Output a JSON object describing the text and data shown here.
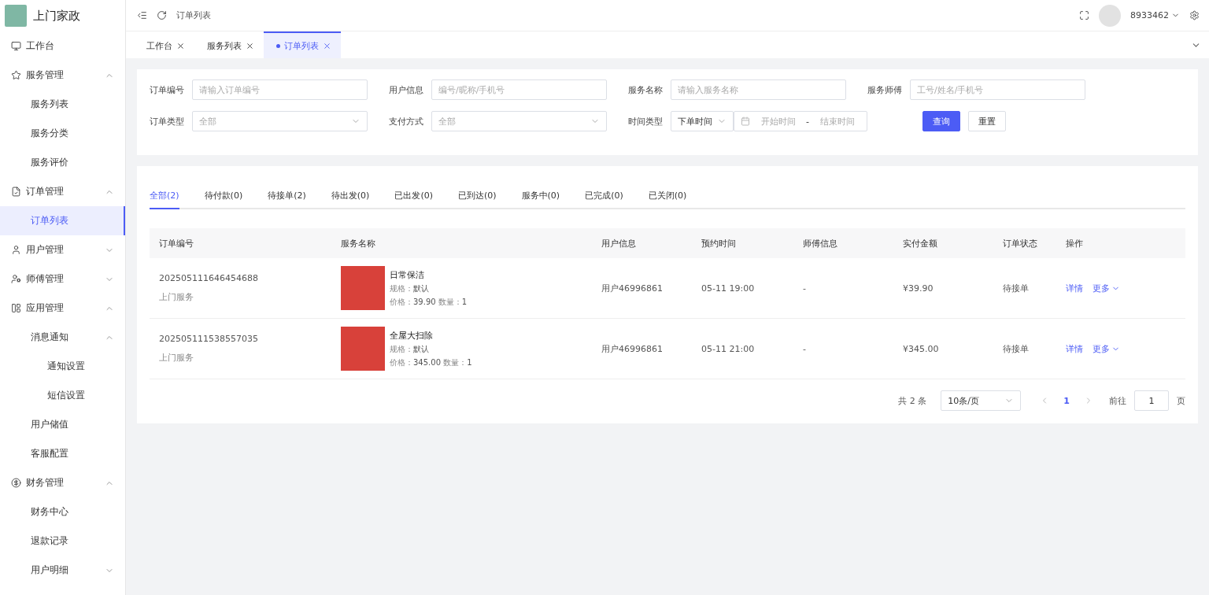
{
  "app": {
    "title": "上门家政"
  },
  "sidebar": {
    "items": [
      {
        "label": "工作台",
        "selected": false
      },
      {
        "label": "服务管理",
        "selected": false,
        "expanded": true,
        "children": [
          {
            "label": "服务列表",
            "selected": false
          },
          {
            "label": "服务分类",
            "selected": false
          },
          {
            "label": "服务评价",
            "selected": false
          }
        ]
      },
      {
        "label": "订单管理",
        "selected": false,
        "expanded": true,
        "children": [
          {
            "label": "订单列表",
            "selected": true
          }
        ]
      },
      {
        "label": "用户管理",
        "selected": false,
        "expanded": false
      },
      {
        "label": "师傅管理",
        "selected": false,
        "expanded": false
      },
      {
        "label": "应用管理",
        "selected": false,
        "expanded": true,
        "children": [
          {
            "label": "消息通知",
            "selected": false,
            "expanded": true,
            "children": [
              {
                "label": "通知设置",
                "selected": false
              },
              {
                "label": "短信设置",
                "selected": false
              }
            ]
          },
          {
            "label": "用户储值",
            "selected": false
          },
          {
            "label": "客服配置",
            "selected": false
          }
        ]
      },
      {
        "label": "财务管理",
        "selected": false,
        "expanded": true,
        "children": [
          {
            "label": "财务中心",
            "selected": false
          },
          {
            "label": "退款记录",
            "selected": false
          },
          {
            "label": "用户明细",
            "selected": false,
            "expanded": false
          }
        ]
      }
    ]
  },
  "header": {
    "breadcrumb": "订单列表",
    "username": "8933462"
  },
  "page_tabs": [
    {
      "label": "工作台",
      "selected": false
    },
    {
      "label": "服务列表",
      "selected": false
    },
    {
      "label": "订单列表",
      "selected": true
    }
  ],
  "filters": [
    {
      "kind": "input",
      "label": "订单编号",
      "placeholder": "请输入订单编号"
    },
    {
      "kind": "input",
      "label": "用户信息",
      "placeholder": "编号/昵称/手机号"
    },
    {
      "kind": "input",
      "label": "服务名称",
      "placeholder": "请输入服务名称"
    },
    {
      "kind": "input",
      "label": "服务师傅",
      "placeholder": "工号/姓名/手机号"
    },
    {
      "kind": "select",
      "label": "订单类型",
      "placeholder": "全部"
    },
    {
      "kind": "select",
      "label": "支付方式",
      "placeholder": "全部"
    },
    {
      "kind": "daterange",
      "label": "时间类型",
      "value": "下单时间",
      "start_placeholder": "开始时间",
      "separator": "-",
      "end_placeholder": "结束时间"
    }
  ],
  "filter_buttons": [
    {
      "label": "查询",
      "kind": "primary"
    },
    {
      "label": "重置",
      "kind": "default"
    }
  ],
  "status_tabs": [
    {
      "label": "全部(2)",
      "selected": true
    },
    {
      "label": "待付款(0)",
      "selected": false
    },
    {
      "label": "待接单(2)",
      "selected": false
    },
    {
      "label": "待出发(0)",
      "selected": false
    },
    {
      "label": "已出发(0)",
      "selected": false
    },
    {
      "label": "已到达(0)",
      "selected": false
    },
    {
      "label": "服务中(0)",
      "selected": false
    },
    {
      "label": "已完成(0)",
      "selected": false
    },
    {
      "label": "已关闭(0)",
      "selected": false
    }
  ],
  "table": {
    "columns": [
      "订单编号",
      "服务名称",
      "用户信息",
      "预约时间",
      "师傅信息",
      "实付金额",
      "订单状态",
      "操作"
    ],
    "rows": [
      {
        "order_no": "202505111646454688",
        "order_type": "上门服务",
        "service": {
          "name": "日常保洁",
          "spec_label": "规格：",
          "spec": "默认",
          "price_label": "价格：",
          "price": "39.90",
          "qty_label": "数量：",
          "qty": "1"
        },
        "user": "用户46996861",
        "time": "05-11 19:00",
        "master": "-",
        "amount": "¥39.90",
        "status": "待接单",
        "actions": [
          "详情",
          "更多"
        ]
      },
      {
        "order_no": "202505111538557035",
        "order_type": "上门服务",
        "service": {
          "name": "全屋大扫除",
          "spec_label": "规格：",
          "spec": "默认",
          "price_label": "价格：",
          "price": "345.00",
          "qty_label": "数量：",
          "qty": "1"
        },
        "user": "用户46996861",
        "time": "05-11 21:00",
        "master": "-",
        "amount": "¥345.00",
        "status": "待接单",
        "actions": [
          "详情",
          "更多"
        ]
      }
    ]
  },
  "pagination": {
    "total": "共 2 条",
    "page_size": "10条/页",
    "pages": [
      {
        "label": "1",
        "selected": true
      }
    ],
    "goto_label": "前往",
    "goto_value": "1",
    "goto_suffix": "页"
  }
}
